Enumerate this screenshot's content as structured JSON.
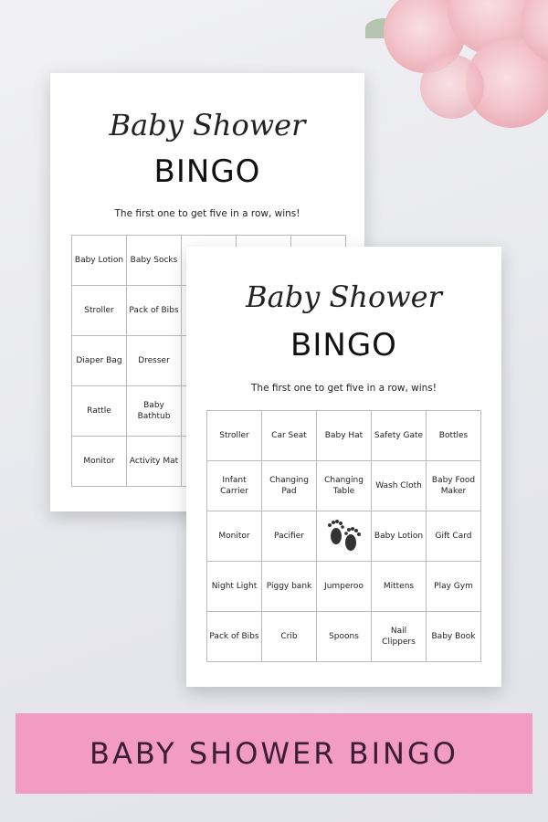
{
  "colors": {
    "banner": "#f29bc3",
    "banner_text": "#3b1d36",
    "background": "#e9eaef"
  },
  "back_card": {
    "script_title": "Baby Shower",
    "title": "BINGO",
    "rule": "The first one to get five in a row, wins!",
    "cells": [
      "Baby Lotion",
      "Baby Socks",
      "",
      "",
      "",
      "Stroller",
      "Pack of Bibs",
      "",
      "",
      "",
      "Diaper Bag",
      "Dresser",
      "",
      "",
      "",
      "Rattle",
      "Baby Bathtub",
      "",
      "",
      "",
      "Monitor",
      "Activity Mat",
      "",
      "",
      ""
    ]
  },
  "front_card": {
    "script_title": "Baby Shower",
    "title": "BINGO",
    "rule": "The first one to get five in a row, wins!",
    "free_icon": "baby-footprints-icon",
    "cells": [
      "Stroller",
      "Car Seat",
      "Baby Hat",
      "Safety Gate",
      "Bottles",
      "Infant Carrier",
      "Changing Pad",
      "Changing Table",
      "Wash Cloth",
      "Baby Food Maker",
      "Monitor",
      "Pacifier",
      "",
      "Baby Lotion",
      "Gift Card",
      "Night Light",
      "Piggy bank",
      "Jumperoo",
      "Mittens",
      "Play Gym",
      "Pack of Bibs",
      "Crib",
      "Spoons",
      "Nail Clippers",
      "Baby Book"
    ]
  },
  "banner": {
    "label": "BABY SHOWER BINGO"
  }
}
